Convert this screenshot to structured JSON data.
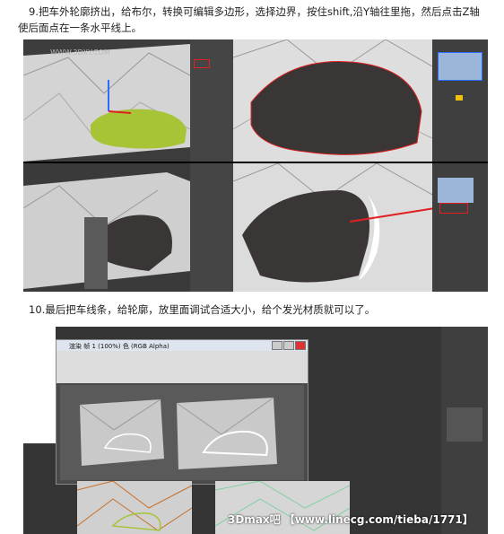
{
  "step9": {
    "line1": "9.把车外轮廓挤出，给布尔，转换可编辑多边形，选择边界，按住shift,沿Y轴往里拖，然后点击Z轴",
    "line2": "使后面点在一条水平线上。"
  },
  "step10": {
    "line1": "10.最后把车线条，给轮廓，放里面调试合适大小，给个发光材质就可以了。"
  },
  "screens": {
    "site_watermark": "WWW.3DXY.COM",
    "site_watermark_2": "WWW.3DXY.COM",
    "forum_watermark": "3Dmax吧 【www.linecg.com/tieba/1771】",
    "window_title": "渲染 帧 1 (100%) 色 (RGB Alpha)"
  },
  "colors": {
    "car_green": "#a7c437",
    "car_dark": "#3b3636",
    "highlight_red": "#e02020",
    "wall_gray": "#c9c9c9",
    "ui_dark": "#2b2b2b"
  }
}
